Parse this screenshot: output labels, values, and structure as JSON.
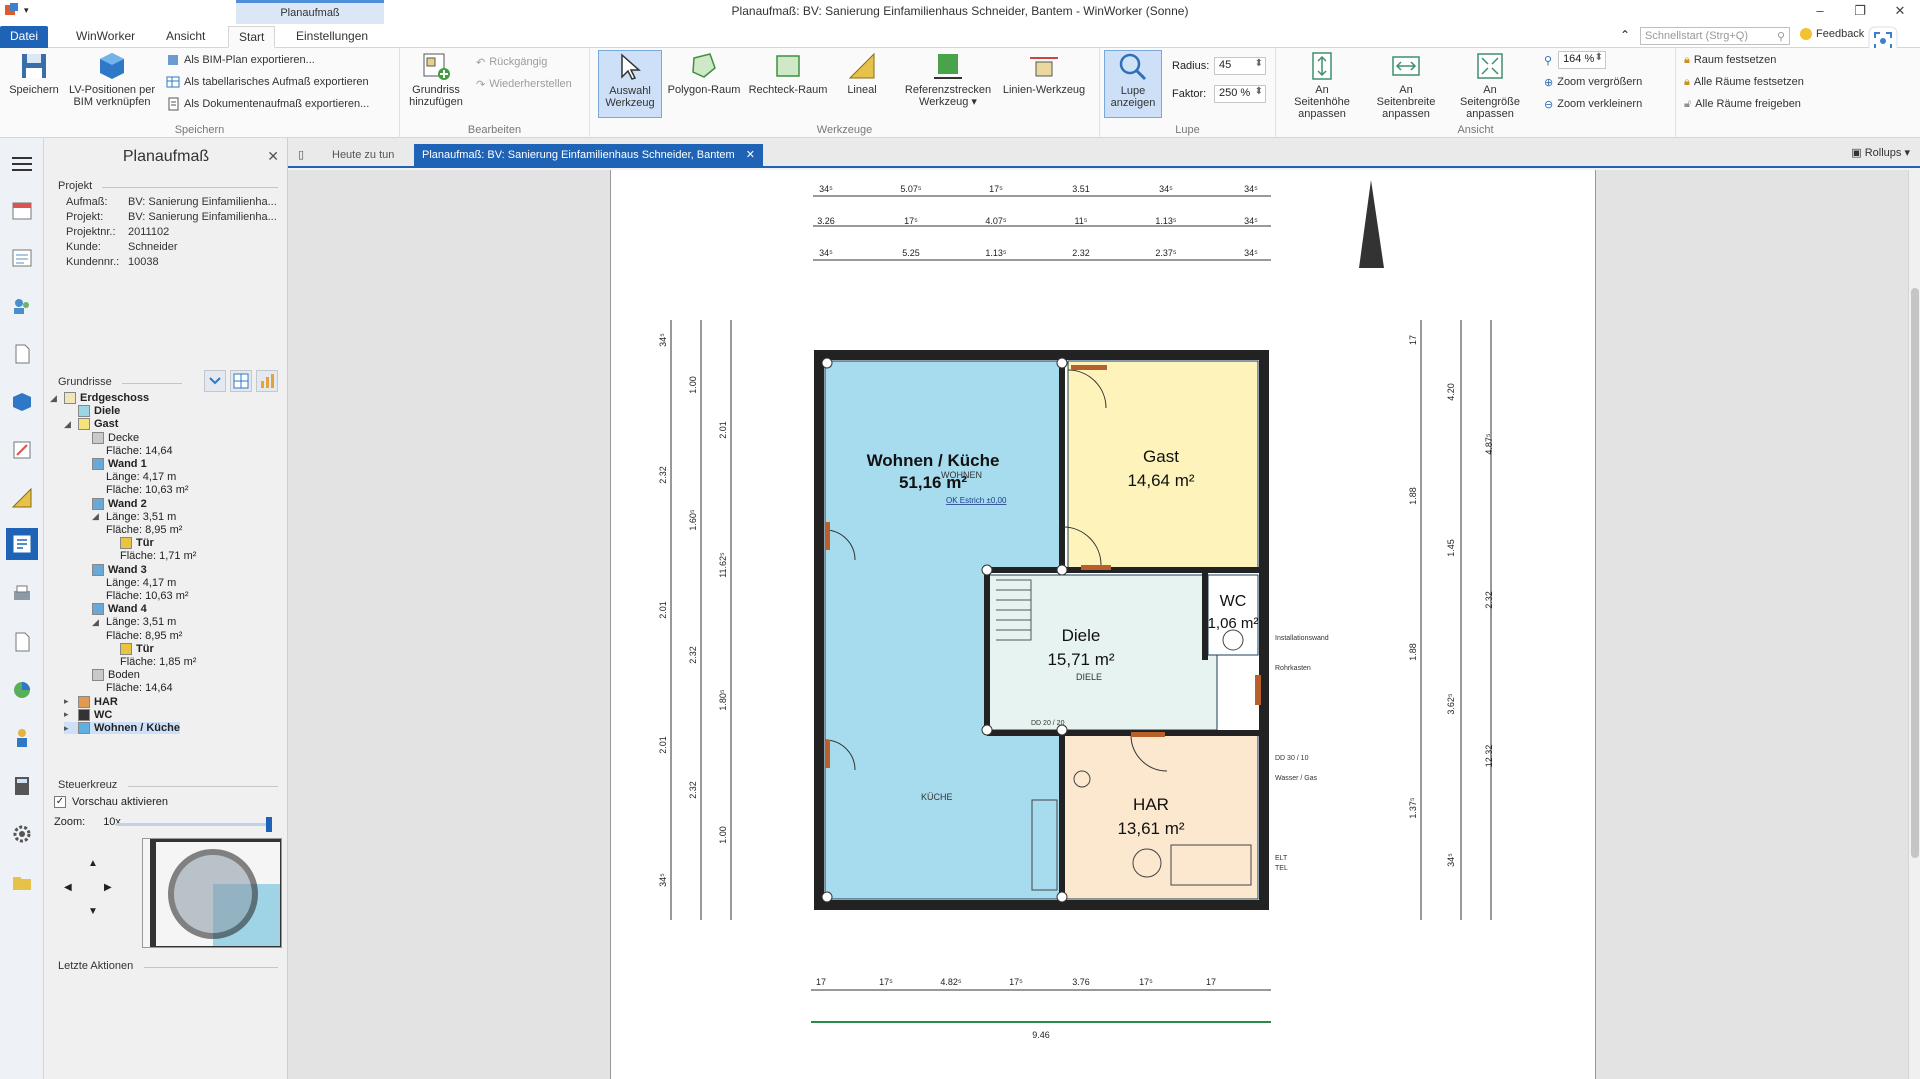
{
  "window": {
    "title": "Planaufmaß: BV: Sanierung Einfamilienhaus Schneider, Bantem - WinWorker (Sonne)",
    "context_tab_caption": "Planaufmaß",
    "controls": {
      "minimize": "–",
      "restore": "❐",
      "close": "✕"
    }
  },
  "ribbon_tabs": [
    "Datei",
    "WinWorker",
    "Ansicht",
    "Start",
    "Einstellungen"
  ],
  "ribbon_active_tab": "Start",
  "quick_search_placeholder": "Schnellstart (Strg+Q)",
  "feedback_label": "Feedback",
  "ribbon": {
    "speichern": {
      "label": "Speichern",
      "save": "Speichern",
      "lv": "LV-Positionen per BIM verknüpfen",
      "export_bim": "Als BIM-Plan exportieren...",
      "export_table": "Als tabellarisches Aufmaß exportieren",
      "export_doc": "Als Dokumentenaufmaß exportieren..."
    },
    "bearbeiten": {
      "label": "Bearbeiten",
      "grundriss": "Grundriss hinzufügen",
      "undo": "Rückgängig",
      "redo": "Wiederherstellen"
    },
    "werkzeuge": {
      "label": "Werkzeuge",
      "auswahl": "Auswahl Werkzeug",
      "polygon": "Polygon-Raum",
      "rechteck": "Rechteck-Raum",
      "lineal": "Lineal",
      "referenz": "Referenzstrecken Werkzeug ▾",
      "linien": "Linien-Werkzeug"
    },
    "lupe": {
      "label": "Lupe",
      "anzeigen": "Lupe anzeigen",
      "radius_label": "Radius:",
      "radius_value": "45",
      "faktor_label": "Faktor:",
      "faktor_value": "250 %"
    },
    "ansicht": {
      "label": "Ansicht",
      "hoehe": "An Seitenhöhe anpassen",
      "breite": "An Seitenbreite anpassen",
      "groesse": "An Seitengröße anpassen",
      "zoom_value": "164 %",
      "zoom_in": "Zoom vergrößern",
      "zoom_out": "Zoom verkleinern"
    },
    "raum": {
      "fest": "Raum festsetzen",
      "alle_fest": "Alle Räume festsetzen",
      "alle_frei": "Alle Räume freigeben"
    }
  },
  "panel": {
    "title": "Planaufmaß",
    "projekt_label": "Projekt",
    "fields": [
      {
        "k": "Aufmaß:",
        "v": "BV: Sanierung Einfamilienha..."
      },
      {
        "k": "Projekt:",
        "v": "BV: Sanierung Einfamilienha..."
      },
      {
        "k": "Projektnr.:",
        "v": "2011102"
      },
      {
        "k": "Kunde:",
        "v": "Schneider"
      },
      {
        "k": "Kundennr.:",
        "v": "10038"
      }
    ],
    "grundrisse_label": "Grundrisse",
    "tree": [
      {
        "text": "Erdgeschoss",
        "bold": true,
        "indent": 0,
        "exp": "◢",
        "color": "#f2e6b8"
      },
      {
        "text": "Diele",
        "bold": true,
        "indent": 1,
        "exp": "",
        "color": "#9fd3e6"
      },
      {
        "text": "Gast",
        "bold": true,
        "indent": 1,
        "exp": "◢",
        "color": "#f5e27a"
      },
      {
        "text": "Decke",
        "bold": false,
        "indent": 2,
        "exp": "",
        "color": "#c9c9c9"
      },
      {
        "text": "Fläche: 14,64",
        "bold": false,
        "indent": 3,
        "exp": "",
        "color": ""
      },
      {
        "text": "Wand 1",
        "bold": true,
        "indent": 2,
        "exp": "",
        "color": "#6aa8d8"
      },
      {
        "text": "Länge: 4,17 m",
        "bold": false,
        "indent": 3,
        "exp": "",
        "color": ""
      },
      {
        "text": "Fläche: 10,63 m²",
        "bold": false,
        "indent": 3,
        "exp": "",
        "color": ""
      },
      {
        "text": "Wand 2",
        "bold": true,
        "indent": 2,
        "exp": "",
        "color": "#6aa8d8"
      },
      {
        "text": "Länge: 3,51 m",
        "bold": false,
        "indent": 3,
        "exp": "◢",
        "color": ""
      },
      {
        "text": "Fläche: 8,95 m²",
        "bold": false,
        "indent": 3,
        "exp": "",
        "color": ""
      },
      {
        "text": "Tür",
        "bold": true,
        "indent": 4,
        "exp": "",
        "color": "#e8c440"
      },
      {
        "text": "Fläche: 1,71 m²",
        "bold": false,
        "indent": 4,
        "exp": "",
        "color": ""
      },
      {
        "text": "Wand 3",
        "bold": true,
        "indent": 2,
        "exp": "",
        "color": "#6aa8d8"
      },
      {
        "text": "Länge: 4,17 m",
        "bold": false,
        "indent": 3,
        "exp": "",
        "color": ""
      },
      {
        "text": "Fläche: 10,63 m²",
        "bold": false,
        "indent": 3,
        "exp": "",
        "color": ""
      },
      {
        "text": "Wand 4",
        "bold": true,
        "indent": 2,
        "exp": "",
        "color": "#6aa8d8"
      },
      {
        "text": "Länge: 3,51 m",
        "bold": false,
        "indent": 3,
        "exp": "◢",
        "color": ""
      },
      {
        "text": "Fläche: 8,95 m²",
        "bold": false,
        "indent": 3,
        "exp": "",
        "color": ""
      },
      {
        "text": "Tür",
        "bold": true,
        "indent": 4,
        "exp": "",
        "color": "#e8c440"
      },
      {
        "text": "Fläche: 1,85 m²",
        "bold": false,
        "indent": 4,
        "exp": "",
        "color": ""
      },
      {
        "text": "Boden",
        "bold": false,
        "indent": 2,
        "exp": "",
        "color": "#c9c9c9"
      },
      {
        "text": "Fläche: 14,64",
        "bold": false,
        "indent": 3,
        "exp": "",
        "color": ""
      },
      {
        "text": "HAR",
        "bold": true,
        "indent": 1,
        "exp": "▸",
        "color": "#e09a52"
      },
      {
        "text": "WC",
        "bold": true,
        "indent": 1,
        "exp": "▸",
        "color": "#333333"
      },
      {
        "text": "Wohnen / Küche",
        "bold": true,
        "indent": 1,
        "exp": "▸",
        "color": "#5fb0e0",
        "selected": true
      }
    ],
    "steuerkreuz_label": "Steuerkreuz",
    "vorschau_label": "Vorschau aktivieren",
    "zoom_label": "Zoom:",
    "zoom_value": "10x",
    "letzte_label": "Letzte Aktionen"
  },
  "doctabs": {
    "heute": "Heute zu tun",
    "active": "Planaufmaß: BV: Sanierung Einfamilienhaus Schneider, Bantem",
    "rollups": "Rollups"
  },
  "plan": {
    "rooms": [
      {
        "name": "Wohnen / Küche",
        "area": "51,16 m²"
      },
      {
        "name": "Gast",
        "area": "14,64 m²"
      },
      {
        "name": "Diele",
        "area": "15,71 m²"
      },
      {
        "name": "WC",
        "area": "1,06 m²"
      },
      {
        "name": "HAR",
        "area": "13,61 m²"
      }
    ],
    "labels": {
      "wohnen_small": "WOHNEN",
      "ok_estrich": "OK Estrich ±0,00",
      "kueche_small": "KÜCHE",
      "diele_small": "DIELE",
      "dd1": "DD 20 / 20",
      "dd2": "DD 20 / 20",
      "dd3": "DD 30 / 10",
      "wasser": "Wasser / Gas",
      "rohrkasten": "Rohrkasten",
      "elt": "ELT",
      "tel": "TEL",
      "installation": "Installationswand"
    },
    "dims_top": [
      "34⁵",
      "5.07⁵",
      "17⁵",
      "3.51",
      "34⁵",
      "34⁵",
      "3.26",
      "17⁵",
      "4.07⁵",
      "11⁵",
      "1.13⁵",
      "34⁵",
      "34⁵",
      "5.25",
      "1.13⁵",
      "2.32",
      "2.37⁵",
      "34⁵"
    ],
    "dims_bottom": [
      "17",
      "17⁵",
      "4.82⁵",
      "17⁵",
      "3.76",
      "17⁵",
      "17",
      "9.46"
    ],
    "dims_left": [
      "34⁵",
      "1.00",
      "2.01",
      "2.32",
      "1.60⁵",
      "11.62⁵",
      "2.01",
      "2.32",
      "1.80⁵",
      "2.01",
      "2.32",
      "1.00",
      "34⁵"
    ],
    "dims_right": [
      "17",
      "4.20",
      "4.87⁵",
      "1.88",
      "1.45",
      "2.32",
      "1.88",
      "3.62⁵",
      "12.32",
      "1.37⁵",
      "34⁵"
    ]
  }
}
